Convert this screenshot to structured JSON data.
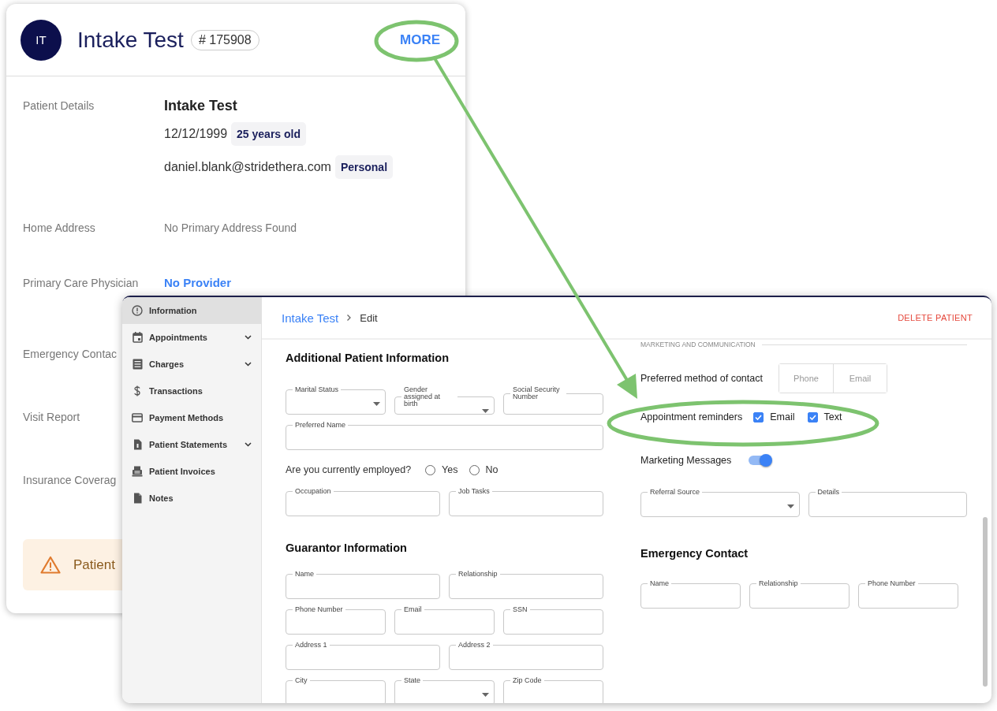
{
  "patient_card": {
    "initials": "IT",
    "title": "Intake Test",
    "badge": "# 175908",
    "more_button": "MORE",
    "rows": [
      {
        "kind": "details",
        "label": "Patient Details",
        "name": "Intake Test",
        "entries": [
          {
            "text": "12/12/1999",
            "chip": "25 years old"
          },
          {
            "text": "daniel.blank@stridethera.com",
            "chip": "Personal"
          }
        ]
      },
      {
        "kind": "muted",
        "label": "Home Address",
        "value": "No Primary Address Found"
      },
      {
        "kind": "link",
        "label": "Primary Care Physician",
        "value": "No Provider"
      },
      {
        "kind": "plain",
        "label": "Emergency Contac"
      },
      {
        "kind": "plain",
        "label": "Visit Report"
      },
      {
        "kind": "plain",
        "label": "Insurance Coverag"
      }
    ],
    "alert": {
      "text": "Patient"
    }
  },
  "edit_window": {
    "sidebar": [
      {
        "label": "Information",
        "selected": true,
        "expandable": false
      },
      {
        "label": "Appointments",
        "selected": false,
        "expandable": true
      },
      {
        "label": "Charges",
        "selected": false,
        "expandable": true
      },
      {
        "label": "Transactions",
        "selected": false,
        "expandable": false
      },
      {
        "label": "Payment Methods",
        "selected": false,
        "expandable": false
      },
      {
        "label": "Patient Statements",
        "selected": false,
        "expandable": true
      },
      {
        "label": "Patient Invoices",
        "selected": false,
        "expandable": false
      },
      {
        "label": "Notes",
        "selected": false,
        "expandable": false
      }
    ],
    "breadcrumb": {
      "parent": "Intake Test",
      "current": "Edit"
    },
    "delete_button": "DELETE PATIENT",
    "left_sections": [
      {
        "title": "Additional Patient Information",
        "rows": [
          {
            "kind": "fields",
            "fields": [
              {
                "label": "Marital Status",
                "select": true
              },
              {
                "label": "Gender assigned at birth",
                "select": true
              },
              {
                "label": "Social Security Number",
                "select": false
              }
            ]
          },
          {
            "kind": "fields",
            "fields": [
              {
                "label": "Preferred Name",
                "select": false
              }
            ]
          },
          {
            "kind": "radio",
            "question": "Are you currently employed?",
            "options": [
              {
                "label": "Yes",
                "selected": false
              },
              {
                "label": "No",
                "selected": false
              }
            ]
          },
          {
            "kind": "fields",
            "fields": [
              {
                "label": "Occupation",
                "select": false
              },
              {
                "label": "Job Tasks",
                "select": false
              }
            ]
          }
        ]
      },
      {
        "title": "Guarantor Information",
        "rows": [
          {
            "kind": "fields",
            "fields": [
              {
                "label": "Name",
                "select": false
              },
              {
                "label": "Relationship",
                "select": false
              }
            ]
          },
          {
            "kind": "fields",
            "fields": [
              {
                "label": "Phone Number",
                "select": false
              },
              {
                "label": "Email",
                "select": false
              },
              {
                "label": "SSN",
                "select": false
              }
            ]
          },
          {
            "kind": "fields",
            "fields": [
              {
                "label": "Address 1",
                "select": false
              },
              {
                "label": "Address 2",
                "select": false
              }
            ]
          },
          {
            "kind": "fields",
            "fields": [
              {
                "label": "City",
                "select": false
              },
              {
                "label": "State",
                "select": true
              },
              {
                "label": "Zip Code",
                "select": false
              }
            ]
          }
        ]
      }
    ],
    "marketing": {
      "section_label": "MARKETING AND COMMUNICATION",
      "contact_label": "Preferred method of contact",
      "contact_options": [
        {
          "label": "Phone",
          "selected": false
        },
        {
          "label": "Email",
          "selected": false
        }
      ],
      "reminders_label": "Appointment reminders",
      "reminders": [
        {
          "label": "Email",
          "checked": true
        },
        {
          "label": "Text",
          "checked": true
        }
      ],
      "marketing_label": "Marketing Messages",
      "marketing_on": true,
      "fields": [
        {
          "label": "Referral Source",
          "select": true
        },
        {
          "label": "Details",
          "select": false
        }
      ]
    },
    "emergency": {
      "title": "Emergency Contact",
      "fields": [
        {
          "label": "Name",
          "select": false
        },
        {
          "label": "Relationship",
          "select": false
        },
        {
          "label": "Phone Number",
          "select": false
        }
      ]
    }
  }
}
